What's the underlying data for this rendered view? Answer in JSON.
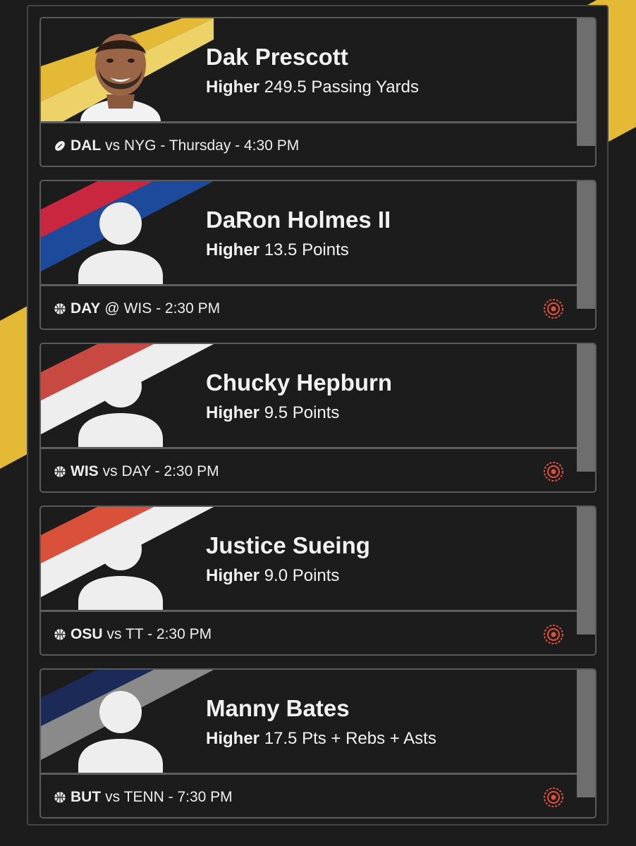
{
  "colors": {
    "background": "#1c1c1c",
    "accent_stripe": "#e3b935",
    "target_icon": "#e2503c"
  },
  "cards": [
    {
      "player": "Dak Prescott",
      "direction": "Higher",
      "line": "249.5 Passing Yards",
      "sport_icon": "football-icon",
      "team": "DAL",
      "matchup": "vs NYG - Thursday - 4:30 PM",
      "stripe_colors": [
        "#e3b935",
        "#ecd267"
      ],
      "has_target_icon": false
    },
    {
      "player": "DaRon Holmes II",
      "direction": "Higher",
      "line": "13.5 Points",
      "sport_icon": "basketball-icon",
      "team": "DAY",
      "matchup": "@ WIS - 2:30 PM",
      "stripe_colors": [
        "#c8273f",
        "#1d4a9b"
      ],
      "has_target_icon": true
    },
    {
      "player": "Chucky Hepburn",
      "direction": "Higher",
      "line": "9.5 Points",
      "sport_icon": "basketball-icon",
      "team": "WIS",
      "matchup": "vs DAY - 2:30 PM",
      "stripe_colors": [
        "#c84a42",
        "#eeeeee"
      ],
      "has_target_icon": true
    },
    {
      "player": "Justice Sueing",
      "direction": "Higher",
      "line": "9.0 Points",
      "sport_icon": "basketball-icon",
      "team": "OSU",
      "matchup": "vs TT - 2:30 PM",
      "stripe_colors": [
        "#d9503b",
        "#eeeeee"
      ],
      "has_target_icon": true
    },
    {
      "player": "Manny Bates",
      "direction": "Higher",
      "line": "17.5 Pts + Rebs + Asts",
      "sport_icon": "basketball-icon",
      "team": "BUT",
      "matchup": "vs TENN - 7:30 PM",
      "stripe_colors": [
        "#1b2a56",
        "#8a8a8a"
      ],
      "has_target_icon": true
    }
  ]
}
